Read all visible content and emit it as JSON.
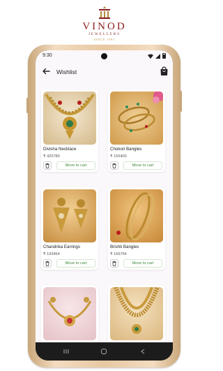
{
  "brand": {
    "name": "VINOD",
    "tagline": "JEWELLERS",
    "since": "SINCE 1981"
  },
  "status_bar": {
    "time": "9:30"
  },
  "header": {
    "title": "Wishlist"
  },
  "wishlist": {
    "move_label": "Move to cart",
    "items": [
      {
        "name": "Divisha Necklace",
        "price": "₹ 425780"
      },
      {
        "name": "Chokori Bangles",
        "price": "₹ 155400"
      },
      {
        "name": "Chandrika Earrings",
        "price": "₹ 193464"
      },
      {
        "name": "Brishti Bangles",
        "price": "₹ 166764"
      },
      {
        "name": "",
        "price": ""
      },
      {
        "name": "",
        "price": ""
      }
    ]
  },
  "colors": {
    "brand": "#8a1d1d",
    "accent_green": "#3f8a3a",
    "background": "#fbf8fb"
  },
  "icons": {
    "back": "arrow-left-icon",
    "bag": "shopping-bag-icon",
    "delete": "trash-icon",
    "nav_recents": "recents-icon",
    "nav_home": "home-icon",
    "nav_back": "back-triangle-icon"
  }
}
